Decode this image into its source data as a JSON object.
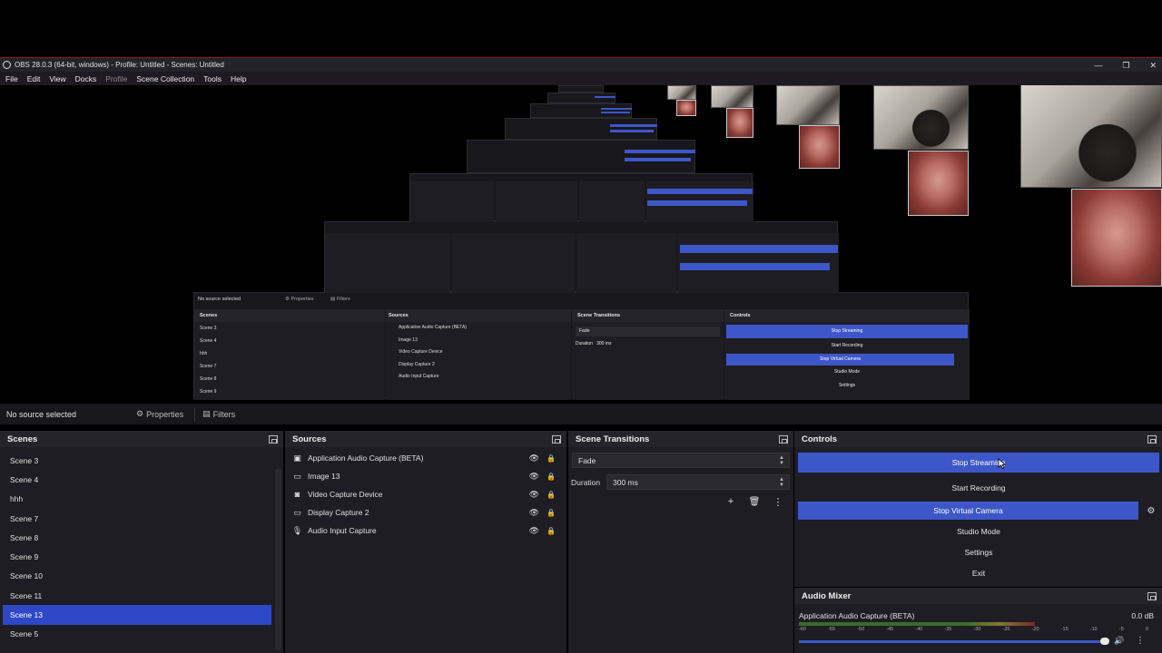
{
  "window": {
    "title": "OBS 28.0.3 (64-bit, windows) - Profile: Untitled - Scenes: Untitled",
    "controls": [
      "—",
      "❐",
      "✕"
    ]
  },
  "menubar": [
    "File",
    "Edit",
    "View",
    "Docks",
    "Profile",
    "Scene Collection",
    "Tools",
    "Help"
  ],
  "status": {
    "no_source": "No source selected",
    "properties": "Properties",
    "filters": "Filters"
  },
  "scenes": {
    "title": "Scenes",
    "items": [
      "Scene 3",
      "Scene 4",
      "hhh",
      "Scene 7",
      "Scene 8",
      "Scene 9",
      "Scene 10",
      "Scene 11",
      "Scene 13",
      "Scene 5"
    ],
    "selected": "Scene 13"
  },
  "sources": {
    "title": "Sources",
    "items": [
      {
        "label": "Application Audio Capture (BETA)",
        "icon": "speaker-icon"
      },
      {
        "label": "Image 13",
        "icon": "image-icon"
      },
      {
        "label": "Video Capture Device",
        "icon": "camera-icon"
      },
      {
        "label": "Display Capture 2",
        "icon": "monitor-icon"
      },
      {
        "label": "Audio Input Capture",
        "icon": "microphone-icon"
      }
    ]
  },
  "transitions": {
    "title": "Scene Transitions",
    "selected": "Fade",
    "duration_label": "Duration",
    "duration_value": "300 ms"
  },
  "controls": {
    "title": "Controls",
    "stop_streaming": "Stop Streaming",
    "start_recording": "Start Recording",
    "stop_virtual_camera": "Stop Virtual Camera",
    "studio_mode": "Studio Mode",
    "settings": "Settings",
    "exit": "Exit"
  },
  "mixer": {
    "title": "Audio Mixer",
    "channel": "Application Audio Capture (BETA)",
    "level": "0.0 dB",
    "scale": [
      "-60",
      "-55",
      "-50",
      "-45",
      "-40",
      "-35",
      "-30",
      "-25",
      "-20",
      "-15",
      "-10",
      "-5",
      "0"
    ],
    "volume_fraction": 1.0
  },
  "preview_recursive": {
    "no_source": "No source selected",
    "properties": "Properties",
    "filters": "Filters",
    "scenes_title": "Scenes",
    "sources_title": "Sources",
    "transitions_title": "Scene Transitions",
    "controls_title": "Controls",
    "scenes": [
      "Scene 3",
      "Scene 4",
      "hhh",
      "Scene 7",
      "Scene 8",
      "Scene 9"
    ],
    "sources": [
      "Application Audio Capture (BETA)",
      "Image 13",
      "Video Capture Device",
      "Display Capture 2",
      "Audio Input Capture"
    ],
    "fade": "Fade",
    "duration": "Duration",
    "duration_value": "300 ms",
    "buttons": [
      "Stop Streaming",
      "Start Recording",
      "Stop Virtual Camera",
      "Studio Mode",
      "Settings"
    ]
  },
  "colors": {
    "accent_blue": "#3d57c9",
    "scene_selected": "#2f48c8",
    "panel_bg": "#1e1d23",
    "title_border": "#7a1f22"
  }
}
